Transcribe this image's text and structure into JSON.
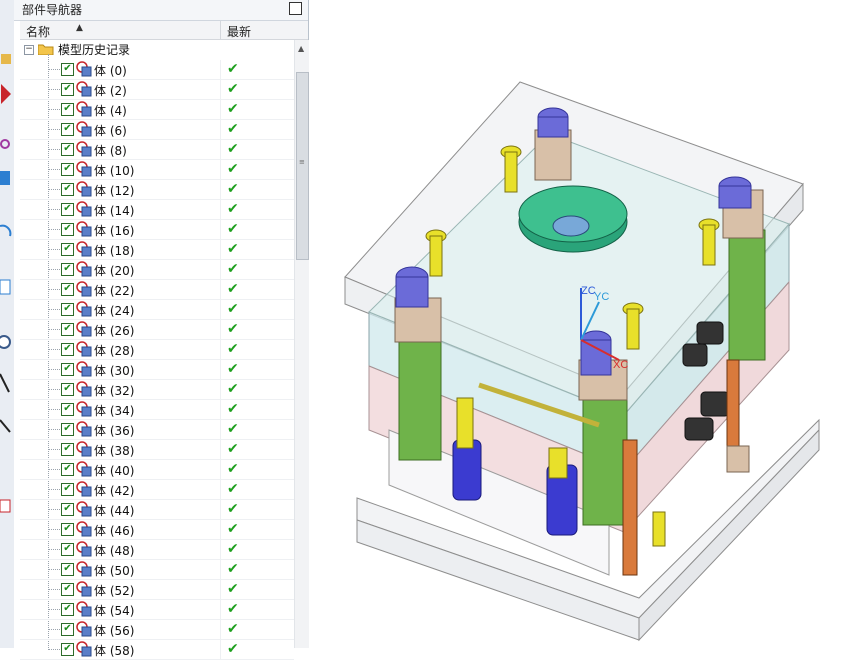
{
  "panel": {
    "title": "部件导航器",
    "col_name": "名称",
    "col_latest": "最新",
    "root_label": "模型历史记录"
  },
  "rows": [
    {
      "label": "体 (0)"
    },
    {
      "label": "体 (2)"
    },
    {
      "label": "体 (4)"
    },
    {
      "label": "体 (6)"
    },
    {
      "label": "体 (8)"
    },
    {
      "label": "体 (10)"
    },
    {
      "label": "体 (12)"
    },
    {
      "label": "体 (14)"
    },
    {
      "label": "体 (16)"
    },
    {
      "label": "体 (18)"
    },
    {
      "label": "体 (20)"
    },
    {
      "label": "体 (22)"
    },
    {
      "label": "体 (24)"
    },
    {
      "label": "体 (26)"
    },
    {
      "label": "体 (28)"
    },
    {
      "label": "体 (30)"
    },
    {
      "label": "体 (32)"
    },
    {
      "label": "体 (34)"
    },
    {
      "label": "体 (36)"
    },
    {
      "label": "体 (38)"
    },
    {
      "label": "体 (40)"
    },
    {
      "label": "体 (42)"
    },
    {
      "label": "体 (44)"
    },
    {
      "label": "体 (46)"
    },
    {
      "label": "体 (48)"
    },
    {
      "label": "体 (50)"
    },
    {
      "label": "体 (52)"
    },
    {
      "label": "体 (54)"
    },
    {
      "label": "体 (56)"
    },
    {
      "label": "体 (58)"
    }
  ],
  "latest_mark": "✔",
  "checkbox_mark": "✔",
  "viewport": {
    "axis_labels": {
      "zc": "ZC",
      "yc": "YC",
      "xc": "XC"
    }
  },
  "colors": {
    "check_green": "#1ea01e",
    "accent_purple": "#6b6bd8",
    "mold_green": "#6fb34a",
    "sprue_green": "#2aa47a"
  }
}
